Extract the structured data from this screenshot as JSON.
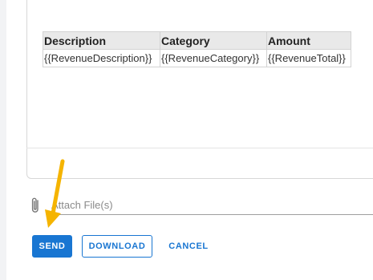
{
  "table": {
    "headers": [
      "Description",
      "Category",
      "Amount"
    ],
    "rows": [
      [
        "{{RevenueDescription}}",
        "{{RevenueCategory}}",
        "{{RevenueTotal}}"
      ]
    ]
  },
  "attach": {
    "icon": "paperclip-icon",
    "label": "Attach File(s)"
  },
  "actions": {
    "send_label": "SEND",
    "download_label": "DOWNLOAD",
    "cancel_label": "CANCEL"
  },
  "colors": {
    "primary": "#1976d2",
    "annotation_arrow": "#f5b400",
    "header_bg": "#e9e9e9"
  }
}
